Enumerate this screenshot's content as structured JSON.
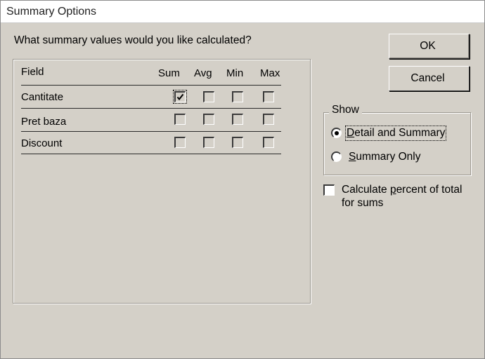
{
  "window": {
    "title": "Summary Options"
  },
  "question": "What summary values would you like calculated?",
  "table": {
    "columns": [
      "Field",
      "Sum",
      "Avg",
      "Min",
      "Max"
    ],
    "rows": [
      {
        "field": "Cantitate",
        "sum": true,
        "avg": false,
        "min": false,
        "max": false
      },
      {
        "field": "Pret baza",
        "sum": false,
        "avg": false,
        "min": false,
        "max": false
      },
      {
        "field": "Discount",
        "sum": false,
        "avg": false,
        "min": false,
        "max": false
      }
    ]
  },
  "buttons": {
    "ok": "OK",
    "cancel": "Cancel"
  },
  "show": {
    "legend": "Show",
    "options": [
      {
        "accel": "D",
        "rest": "etail and Summary",
        "selected": true
      },
      {
        "accel": "S",
        "rest": "ummary Only",
        "selected": false
      }
    ]
  },
  "percent": {
    "line1_pre": "Calculate ",
    "line1_accel": "p",
    "line1_post": "ercent of total",
    "line2": "for sums",
    "checked": false
  }
}
